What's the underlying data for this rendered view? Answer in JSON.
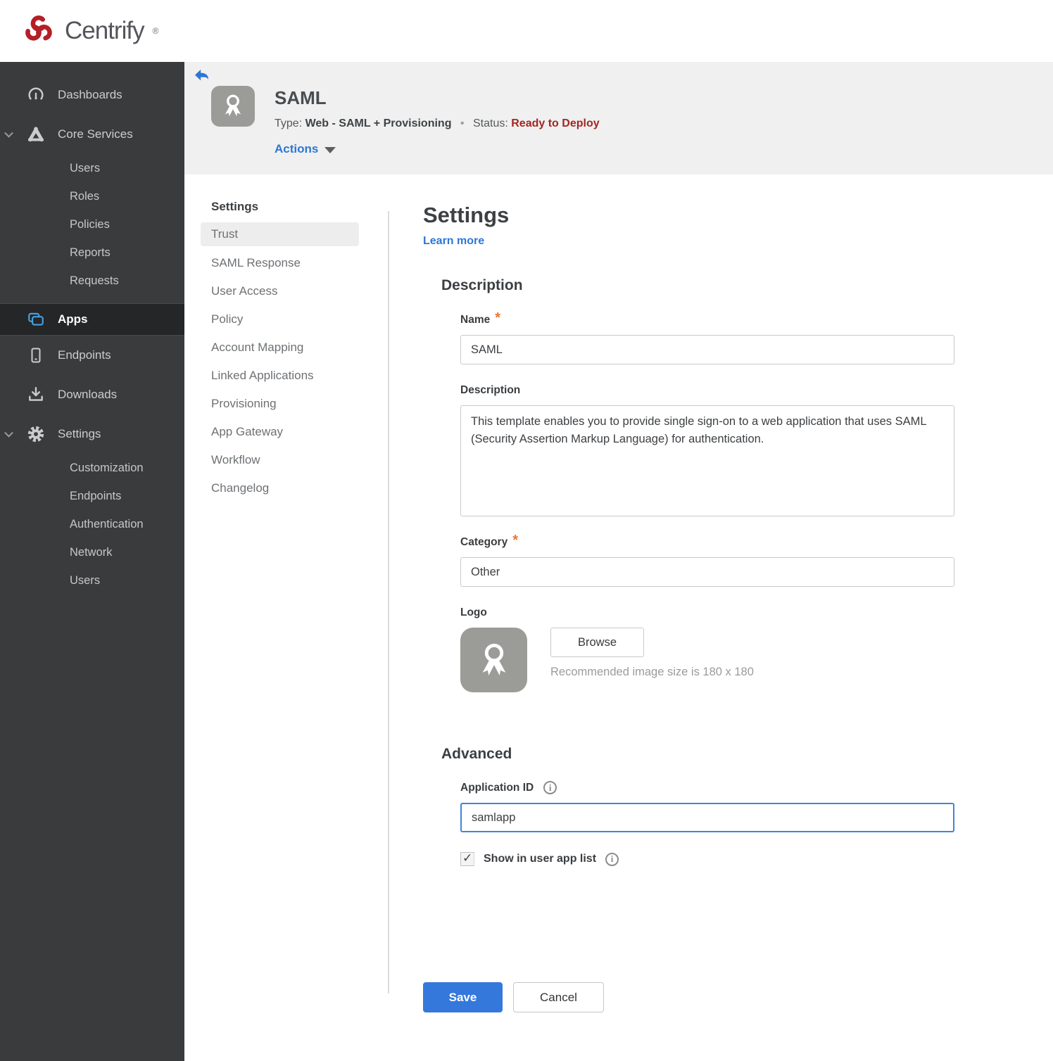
{
  "brand": {
    "name": "Centrify",
    "trademark": "®"
  },
  "sidebar": {
    "items": [
      {
        "label": "Dashboards"
      },
      {
        "label": "Core Services"
      },
      {
        "label": "Apps"
      },
      {
        "label": "Endpoints"
      },
      {
        "label": "Downloads"
      },
      {
        "label": "Settings"
      }
    ],
    "core_services_children": [
      "Users",
      "Roles",
      "Policies",
      "Reports",
      "Requests"
    ],
    "settings_children": [
      "Customization",
      "Endpoints",
      "Authentication",
      "Network",
      "Users"
    ]
  },
  "header": {
    "title": "SAML",
    "type_label": "Type:",
    "type_value": "Web - SAML + Provisioning",
    "separator": "•",
    "status_label": "Status:",
    "status_value": "Ready to Deploy",
    "actions_label": "Actions"
  },
  "subnav": {
    "heading": "Settings",
    "items": [
      "Trust",
      "SAML Response",
      "User Access",
      "Policy",
      "Account Mapping",
      "Linked Applications",
      "Provisioning",
      "App Gateway",
      "Workflow",
      "Changelog"
    ],
    "active_item": "Trust"
  },
  "form": {
    "title": "Settings",
    "learn_more": "Learn more",
    "required_mark": "*",
    "description_section": "Description",
    "name_label": "Name",
    "name_value": "SAML",
    "description_label": "Description",
    "description_value": "This template enables you to provide single sign-on to a web application that uses SAML (Security Assertion Markup Language) for authentication.",
    "category_label": "Category",
    "category_value": "Other",
    "logo_label": "Logo",
    "browse_label": "Browse",
    "logo_hint": "Recommended image size is 180 x 180",
    "advanced_section": "Advanced",
    "app_id_label": "Application ID",
    "app_id_value": "samlapp",
    "show_in_list_label": "Show in user app list",
    "save_label": "Save",
    "cancel_label": "Cancel"
  },
  "colors": {
    "accent_blue": "#3478dc",
    "link_blue": "#2d77d4",
    "status_red": "#a32622",
    "apps_icon_blue": "#4aa0dc",
    "asterisk_orange": "#e8772e",
    "sidebar_bg": "#3a3b3d",
    "header_bg": "#f0f0f0",
    "brand_red": "#b32025"
  }
}
